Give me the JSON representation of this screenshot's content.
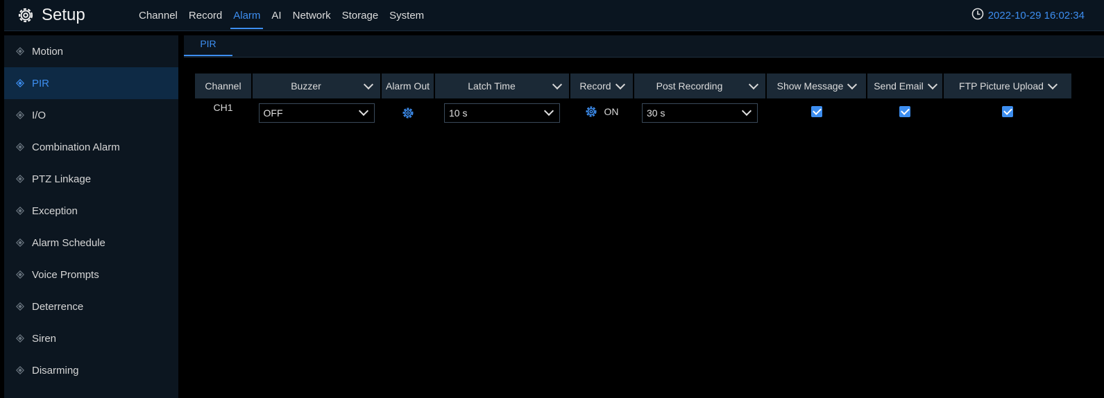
{
  "app": {
    "title": "Setup"
  },
  "nav": {
    "items": [
      "Channel",
      "Record",
      "Alarm",
      "AI",
      "Network",
      "Storage",
      "System"
    ],
    "active_index": 2
  },
  "clock": {
    "datetime": "2022-10-29 16:02:34"
  },
  "sidebar": {
    "items": [
      {
        "label": "Motion"
      },
      {
        "label": "PIR"
      },
      {
        "label": "I/O"
      },
      {
        "label": "Combination Alarm"
      },
      {
        "label": "PTZ Linkage"
      },
      {
        "label": "Exception"
      },
      {
        "label": "Alarm Schedule"
      },
      {
        "label": "Voice Prompts"
      },
      {
        "label": "Deterrence"
      },
      {
        "label": "Siren"
      },
      {
        "label": "Disarming"
      }
    ],
    "active_index": 1
  },
  "subtabs": {
    "active": "PIR"
  },
  "table": {
    "headers": {
      "channel": "Channel",
      "buzzer": "Buzzer",
      "alarm_out": "Alarm Out",
      "latch_time": "Latch Time",
      "record": "Record",
      "post_recording": "Post Recording",
      "show_message": "Show Message",
      "send_email": "Send Email",
      "ftp_upload": "FTP Picture Upload"
    },
    "rows": [
      {
        "channel": "CH1",
        "buzzer": "OFF",
        "latch_time": "10 s",
        "record": "ON",
        "post_recording": "30 s",
        "show_message": true,
        "send_email": true,
        "ftp_upload": true
      }
    ]
  },
  "colors": {
    "accent": "#3d8ef0",
    "sidebar_bg": "#0c1620",
    "header_bg": "#1b2936",
    "active_bg": "#0e2a45"
  }
}
